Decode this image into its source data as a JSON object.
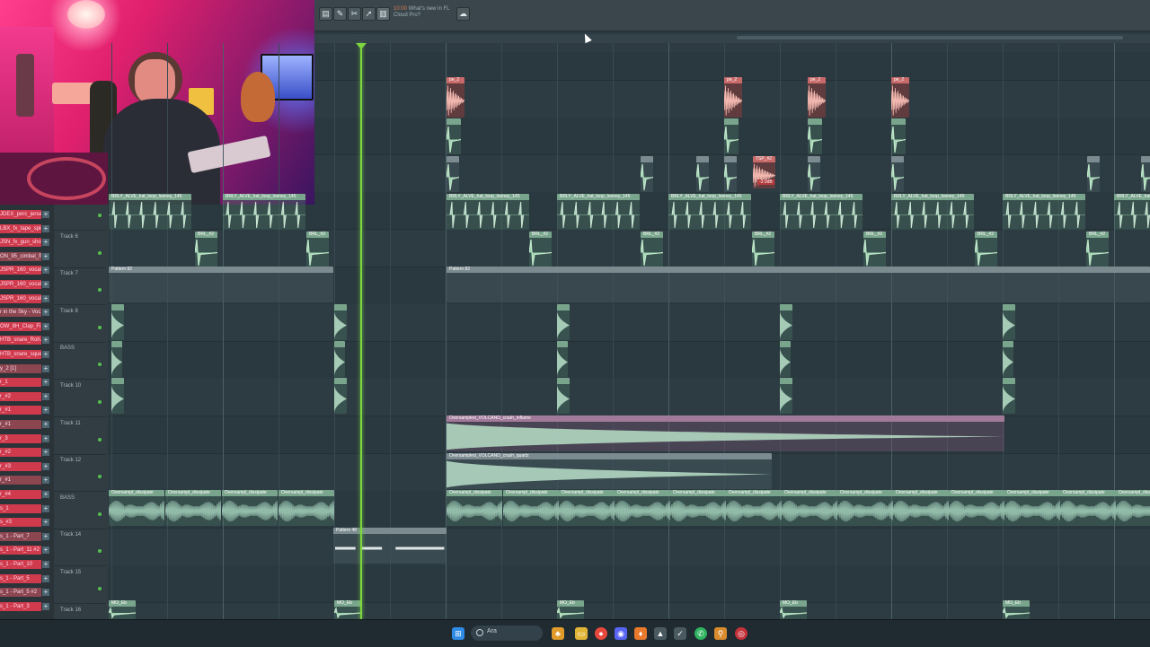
{
  "toolbar": {
    "hint_time": "10:00",
    "hint_text": "What's new in FL Cloud Pro?"
  },
  "channels": [
    "JDEX_perc_jersey...",
    "LBX_fx_tape_spinba...",
    "JSN_fx_gun_shot",
    "ON_95_cimbal_fl...",
    "JSPR_160_vocal...",
    "JSPR_160_vocal...",
    "JSPR_160_vocal...",
    "r in the Sky - Voc...",
    "OW_8H_Clap_Fi...",
    "HTB_snare_Roh...",
    "HTB_snare_squea...",
    "y_2 [1]",
    "r_1",
    "r_#2",
    "r_#1",
    "r_#1",
    "r_3",
    "r_#2",
    "r_#3",
    "r_#1",
    "r_#4",
    "s_1",
    "s_#3",
    "s_1 - Part_7",
    "s_1 - Part_11 #2",
    "s_1 - Part_10",
    "s_1 - Part_5",
    "s_1 - Part_5 #2",
    "s_1 - Part_3"
  ],
  "tracks": [
    {
      "label": ""
    },
    {
      "label": "Track 6"
    },
    {
      "label": "Track 7"
    },
    {
      "label": "Track 8"
    },
    {
      "label": "BASS"
    },
    {
      "label": "Track 10"
    },
    {
      "label": "Track 11"
    },
    {
      "label": "Track 12"
    },
    {
      "label": "BASS"
    },
    {
      "label": "Track 14"
    },
    {
      "label": "Track 15"
    },
    {
      "label": "Track 16"
    }
  ],
  "clips": {
    "pe_2": "pe_2",
    "tsp_2": "TSP_#2",
    "tsp_db": "-3.0dB",
    "hat_loop": "BRLY_ALVE_hat_loop_looney_145",
    "brl": "BRL_#2",
    "pattern82": "Pattern 82",
    "pattern48": "Pattern 48",
    "crash_inflame": "Oversampled_VOLCANO_crash_inflame",
    "crash_quartz": "Oversampled_VOLCANO_crash_quartz",
    "dissipate": "Oversampl_dissipate",
    "db": "-3.0dB",
    "mo": "MO_Eb"
  },
  "taskbar": {
    "search_text": "Ara"
  },
  "colors": {
    "playhead": "#7cd63f",
    "channel_red": "#cf3a4c",
    "background": "#2b3a41"
  }
}
